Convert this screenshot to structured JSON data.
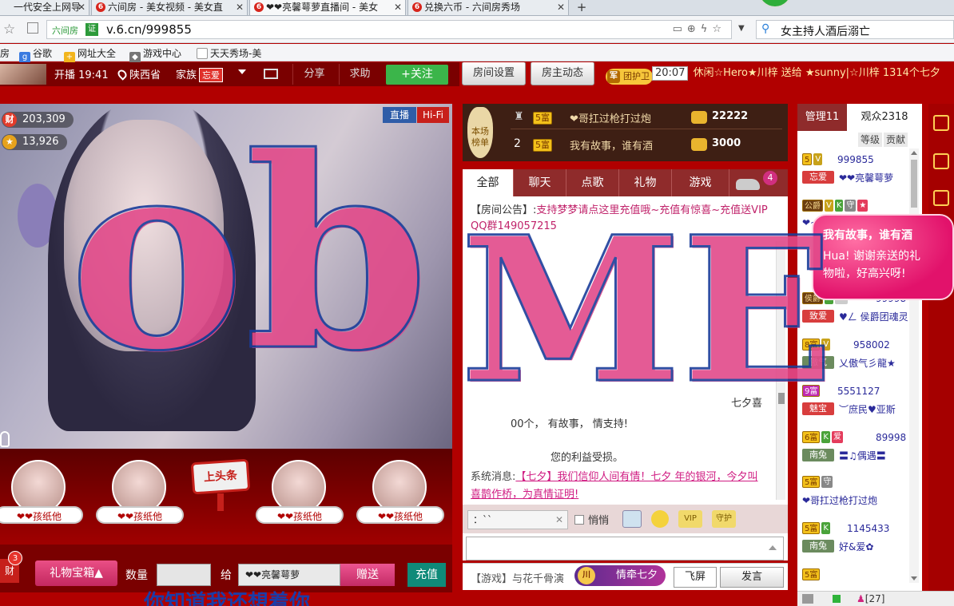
{
  "browser": {
    "tabs": [
      {
        "label": "一代安全上网导",
        "active": false
      },
      {
        "label": "六间房 - 美女视频 - 美女直",
        "active": false
      },
      {
        "label": "❤❤亮馨萼萝直播间 - 美女",
        "active": true
      },
      {
        "label": "兑换六币 - 六间房秀场",
        "active": false
      }
    ],
    "new_tab": "+",
    "address": {
      "site_label": "六间房",
      "cert": "证",
      "url": "v.6.cn/999855"
    },
    "search_query": "女主持人酒后溺亡",
    "bookmarks": [
      "房",
      "谷歌",
      "网址大全",
      "游戏中心",
      "天天秀场-美"
    ]
  },
  "room": {
    "broadcast_start": "开播 19:41",
    "location": "陕西省",
    "family_label": "家族",
    "family_badge": "忘爱",
    "share": "分享",
    "ask": "求助",
    "follow": "+关注",
    "room_settings": "房间设置",
    "owner_news": "房主动态",
    "guard_badge": "团护卫",
    "guard_icon": "军",
    "ticker_time": "20:07",
    "ticker_text": "休闲☆Hero★川梓 送给 ★sunny|☆川梓 1314个七夕"
  },
  "video": {
    "wealth_icon": "财",
    "wealth_value": "203,309",
    "star_value": "13,926",
    "live_tag": "直播",
    "hifi_tag": "Hi-Fi",
    "overlay_left": "ob",
    "overlay_right": "ME"
  },
  "fans": {
    "items": [
      {
        "name": "❤❤孩纸他"
      },
      {
        "name": "❤❤孩纸他"
      },
      {
        "name": "❤❤孩纸他"
      },
      {
        "name": "❤❤孩纸他"
      }
    ],
    "headline": "上头条"
  },
  "bottom": {
    "wealth": "财",
    "wealth_count": "3",
    "gift_box": "礼物宝箱▲",
    "qty_label": "数量",
    "to_label": "给",
    "recipient": "❤❤亮馨萼萝",
    "send": "赠送",
    "recharge": "充值",
    "marquee": "你知道我还想着你"
  },
  "ranking": {
    "title": "本场榜单",
    "rows": [
      {
        "rank": "",
        "level": "5富",
        "name": "❤哥扛过枪打过炮",
        "value": "22222"
      },
      {
        "rank": "2",
        "level": "5富",
        "name": "我有故事，谁有酒",
        "value": "3000"
      }
    ]
  },
  "chat": {
    "tabs": [
      "全部",
      "聊天",
      "点歌",
      "礼物",
      "游戏"
    ],
    "car_badge": "4",
    "notice_head": "【房间公告】:",
    "notice_body": "支持梦梦请点这里充值哦~充值有惊喜~充值送VIP QQ群149057215",
    "msg_partial_1": "七夕喜",
    "msg_partial_2": "00个，   有故事，     情支持!",
    "msg_partial_3": "您的利益受损。",
    "system_prefix": "系统消息:",
    "system_link": "【七夕】我们信仰人间有情！七夕  年的银河，今夕叫喜鹊作桥，为真情证明!",
    "target": "：``",
    "whisper": "悄悄",
    "vip": "VIP",
    "guard": "守护"
  },
  "chat_bottom": {
    "game_line": "【游戏】与花千骨演",
    "qixi": "情牵七夕",
    "qixi_icon": "川",
    "fly": "飞屏",
    "say": "发言"
  },
  "audience": {
    "tab_admin": "管理11",
    "tab_audience": "观众2318",
    "sort_level": "等级",
    "sort_contrib": "贡献",
    "users": [
      {
        "badges": [
          "5",
          "V"
        ],
        "uid": "999855",
        "fam": "忘爱",
        "fam_red": true,
        "nick": "❤❤亮馨萼萝"
      },
      {
        "badges": [
          "公爵",
          "V",
          "K",
          "守",
          "★"
        ],
        "uid": "",
        "fam": "",
        "fam_red": false,
        "nick": "❤~"
      },
      {
        "badges": [
          "",
          "",
          "",
          ""
        ],
        "uid": "",
        "fam": "",
        "fam_red": false,
        "nick": ""
      },
      {
        "badges": [
          "侯爵",
          "K",
          ""
        ],
        "uid": "99998",
        "fam": "致爱",
        "fam_red": true,
        "nick": "♥ㄥ 侯爵团魂灵"
      },
      {
        "badges": [
          "8富",
          "V"
        ],
        "uid": "958002",
        "fam": "傲气",
        "fam_red": false,
        "nick": "乂傲气彡龍★"
      },
      {
        "badges": [
          "9富"
        ],
        "uid": "5551127",
        "fam": "魅宝",
        "fam_red": true,
        "nick": "︶庶民♥亚斯"
      },
      {
        "badges": [
          "6富",
          "K",
          "爱"
        ],
        "uid": "89998",
        "fam": "南兔",
        "fam_red": false,
        "nick": "〓♫偶遇〓"
      },
      {
        "badges": [
          "5富",
          "守"
        ],
        "uid": "",
        "fam": "",
        "fam_red": false,
        "nick": "❤哥扛过枪打过炮"
      },
      {
        "badges": [
          "5富",
          "K"
        ],
        "uid": "1145433",
        "fam": "南兔",
        "fam_red": false,
        "nick": "好&爱✿"
      },
      {
        "badges": [
          "5富"
        ],
        "uid": "",
        "fam": "",
        "fam_red": false,
        "nick": ""
      }
    ]
  },
  "bubble": {
    "line1": "我有故事，谁有酒",
    "line2": "Hua! 谢谢亲送的礼",
    "line3": "物啦，好高兴呀!"
  },
  "status": {
    "online": "[27]"
  },
  "colors": {
    "page_bg": "#b10000",
    "accent_green": "#3bb54a",
    "accent_pink": "#d01c82",
    "gold": "#f3c11b"
  }
}
